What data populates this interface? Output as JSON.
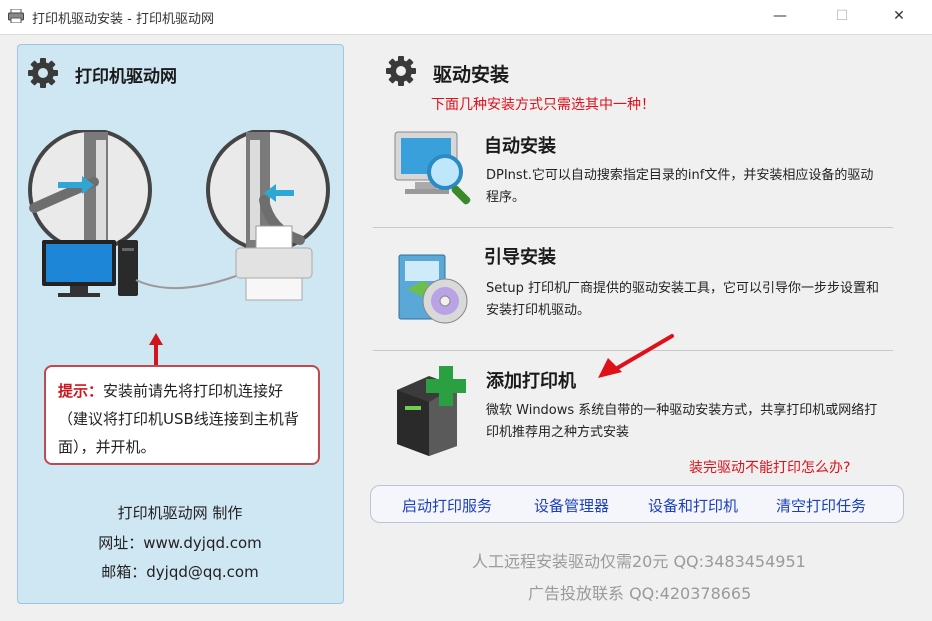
{
  "window": {
    "title": "打印机驱动安装 - 打印机驱动网",
    "controls": {
      "minimize": "—",
      "maximize": "☐",
      "close": "✕"
    }
  },
  "left_panel": {
    "title": "打印机驱动网",
    "tip_label": "提示：",
    "tip_text": "安装前请先将打印机连接好（建议将打印机USB线连接到主机背面），并开机。",
    "maker": "打印机驱动网  制作",
    "website": "网址：www.dyjqd.com",
    "email": "邮箱：dyjqd@qq.com"
  },
  "right_panel": {
    "title": "驱动安装",
    "subtitle": "下面几种安装方式只需选其中一种！",
    "options": [
      {
        "title": "自动安装",
        "description": "DPInst.它可以自动搜索指定目录的inf文件，并安装相应设备的驱动程序。"
      },
      {
        "title": "引导安装",
        "description": "Setup 打印机厂商提供的驱动安装工具，它可以引导你一步步设置和安装打印机驱动。"
      },
      {
        "title": "添加打印机",
        "description": "微软 Windows 系统自带的一种驱动安装方式，共享打印机或网络打印机推荐用之种方式安装"
      }
    ],
    "help_link": "装完驱动不能打印怎么办?",
    "service_buttons": [
      "启动打印服务",
      "设备管理器",
      "设备和打印机",
      "清空打印任务"
    ],
    "footer_line1": "人工远程安装驱动仅需20元 QQ:3483454951",
    "footer_line2": "广告投放联系 QQ:420378665"
  },
  "colors": {
    "left_panel_bg": "#cfe6f3",
    "accent_red": "#e0101a",
    "link_blue": "#1c3fbd"
  }
}
